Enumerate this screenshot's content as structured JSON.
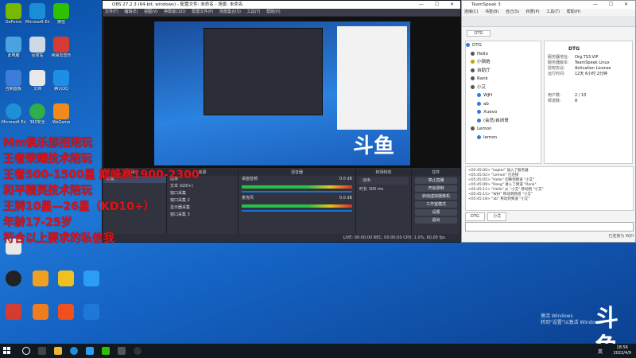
{
  "desktop": {
    "icons": [
      {
        "label": "GeForce",
        "color": "#76b900"
      },
      {
        "label": "Microsoft Edge",
        "color": "#1a8cd8"
      },
      {
        "label": "微信",
        "color": "#2dc100"
      },
      {
        "label": "此电脑",
        "color": "#4aa3df"
      },
      {
        "label": "回收站",
        "color": "#cfd8e3"
      },
      {
        "label": "网易云音乐",
        "color": "#d43c33"
      },
      {
        "label": "控制面板",
        "color": "#3b7dd8"
      },
      {
        "label": "文档",
        "color": "#e8e8e8"
      },
      {
        "label": "腾讯QQ",
        "color": "#1f8fe6"
      },
      {
        "label": "Microsoft Edge",
        "color": "#1e90d8"
      },
      {
        "label": "360安全",
        "color": "#2fae4a"
      },
      {
        "label": "WeGame",
        "color": "#f08a1c"
      }
    ]
  },
  "overlay": {
    "lines": [
      "Mm俱乐部招陪玩",
      "王者荣耀技术陪玩",
      "王者500-1500星 巅峰赛1900-2300",
      "和平精英技术陪玩",
      "王牌10星—26星（KD10+）",
      "年龄17-25岁",
      "符合以上要求的私信我"
    ]
  },
  "obs": {
    "title": "OBS 27.2.3 (64-bit, windows) - 配置文件: 未命名 - 场景: 未命名",
    "menu": [
      "文件(F)",
      "编辑(E)",
      "视图(V)",
      "停靠窗口(D)",
      "配置文件(P)",
      "场景集合(S)",
      "工具(T)",
      "帮助(H)"
    ],
    "docks": {
      "scenes": "场景",
      "sources": "来源",
      "mixer": "混音器",
      "transitions": "转场特效",
      "controls": "控件"
    },
    "scene_items": [
      "场景"
    ],
    "source_items": [
      "图像",
      "文本 (GDI+)",
      "窗口采集",
      "窗口采集 2",
      "显示器采集",
      "窗口采集 3"
    ],
    "mixer_channels": [
      "桌面音频",
      "麦克风"
    ],
    "mixer_db": [
      "0.0 dB",
      "0.0 dB"
    ],
    "transition": "淡出",
    "duration_label": "时长",
    "duration": "300 ms",
    "controls": [
      "停止直播",
      "开始录制",
      "启动虚拟摄像机",
      "工作室模式",
      "设置",
      "退出"
    ],
    "status": "LIVE: 00:00:00  REC: 00:00:00  CPU: 1.0%, 60.00 fps"
  },
  "ts": {
    "title": "TeamSpeak 3",
    "menu": [
      "连接(C)",
      "书签(B)",
      "自己(S)",
      "权限(P)",
      "工具(T)",
      "帮助(H)"
    ],
    "tab": "DTG",
    "tree": [
      "DTG",
      "Hello",
      "小钢炮",
      "自助厅",
      "Rank",
      "小艾",
      "WJH",
      "ab",
      "Xuevo",
      "(会员)自闭哥",
      "Lemon",
      "lemon"
    ],
    "info": {
      "title": "DTG",
      "rows": [
        {
          "k": "服务器地址:",
          "v": "Org.TS3.VIP"
        },
        {
          "k": "服务器版本:",
          "v": "TeamSpeak Linux"
        },
        {
          "k": "授权协议:",
          "v": "Activation License"
        },
        {
          "k": "运行时间:",
          "v": "12天 6小时 2分钟"
        },
        {
          "k": "用户数:",
          "v": "2 / 10"
        },
        {
          "k": "频道数:",
          "v": "8"
        }
      ]
    },
    "chat": [
      "<05:45:00> \"kopier\" 加入了服务器",
      "<05:45:02> \"Lemon\" 已连接",
      "<05:45:05> \"Hello\" 切换到频道 \"小艾\"",
      "<05:45:09> \"Rang\" 进入了频道 \"Rank\"",
      "<05:45:11> \"Hello\" 从 \"小艾\" 移动到 \"小艾\"",
      "<05:45:15> \"WJH\" 移动到频道 \"小艾\"",
      "<05:45:18> \"ab\" 移动到频道 \"小艾\""
    ],
    "chat_tabs": [
      "DTG",
      "小艾"
    ],
    "status": "已连接为 WJH"
  },
  "watermark": {
    "activate_line1": "激活 Windows",
    "activate_line2": "转到\"设置\"以激活 Windows。",
    "logo": "斗鱼"
  },
  "taskbar": {
    "time": "18:56",
    "date": "2022/4/9",
    "ime": "英"
  }
}
